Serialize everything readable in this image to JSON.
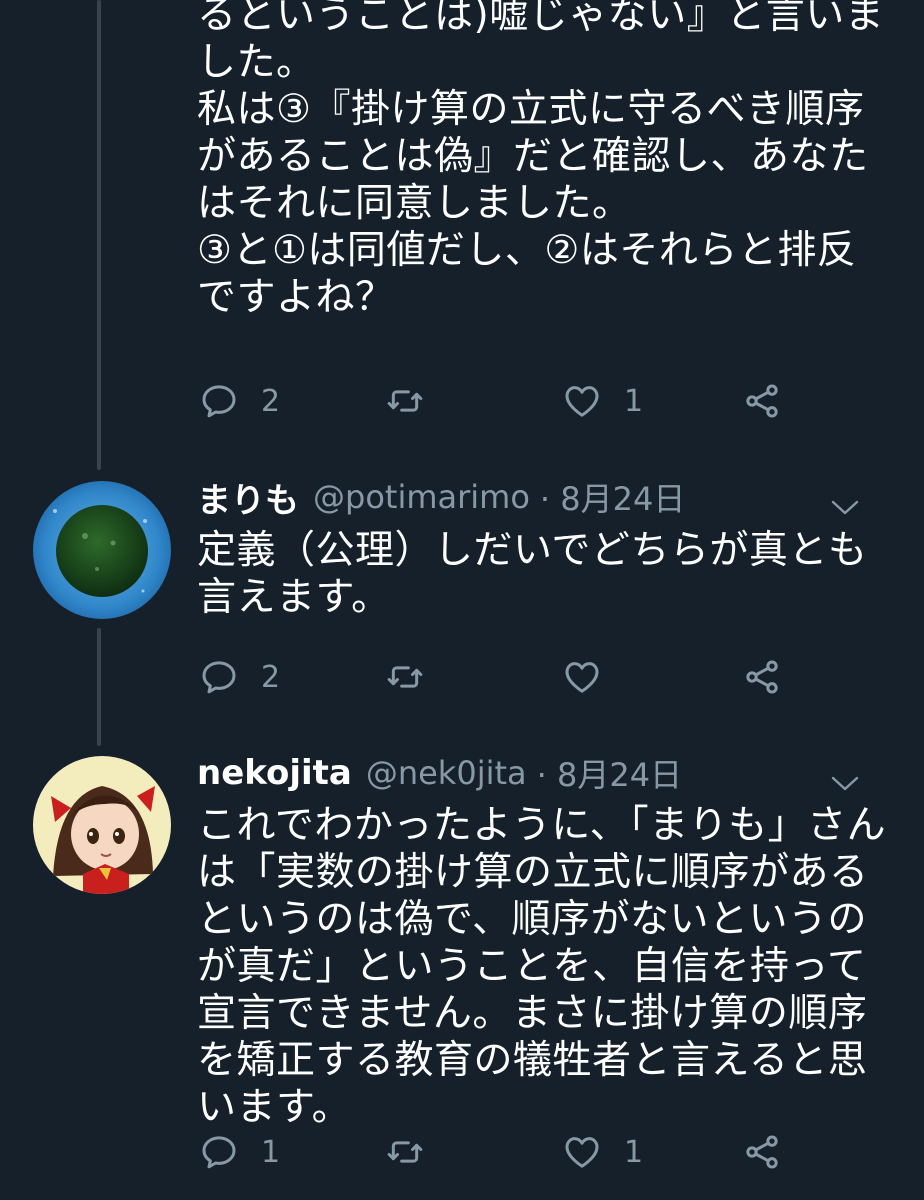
{
  "tweets": [
    {
      "text": "るということは)嘘じゃない』と言いました。\n私は③『掛け算の立式に守るべき順序があることは偽』だと確認し、あなたはそれに同意しました。\n③と①は同値だし、②はそれらと排反ですよね？",
      "replies": "2",
      "retweets": "",
      "likes": "1"
    },
    {
      "display_name": "まりも",
      "handle": "@potimarimo",
      "date": "· 8月24日",
      "text": "定義（公理）しだいでどちらが真とも言えます。",
      "replies": "2",
      "retweets": "",
      "likes": ""
    },
    {
      "display_name": "nekojita",
      "handle": "@nek0jita",
      "date": "· 8月24日",
      "text": "これでわかったように、「まりも」さんは「実数の掛け算の立式に順序があるというのは偽で、順序がないというのが真だ」ということを、自信を持って宣言できません。まさに掛け算の順序を矯正する教育の犠牲者と言えると思います。",
      "replies": "1",
      "retweets": "",
      "likes": "1"
    }
  ],
  "colors": {
    "background": "#15202b",
    "text": "#ffffff",
    "secondary": "#8899a6",
    "thread_line": "#38444d"
  },
  "icons": [
    "reply-icon",
    "retweet-icon",
    "like-icon",
    "share-icon",
    "chevron-down-icon"
  ]
}
